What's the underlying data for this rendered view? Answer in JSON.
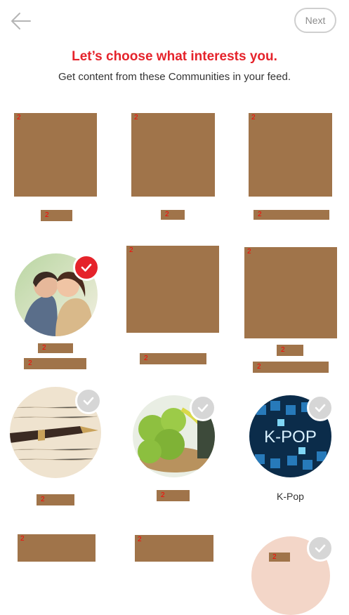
{
  "header": {
    "next_label": "Next",
    "title": "Let’s choose what interests you.",
    "subtitle": "Get content from these Communities in your feed."
  },
  "grid": {
    "placeholder_mark": "2",
    "kpop_label": "K-Pop",
    "kpop_logo_text": "K-POP"
  },
  "colors": {
    "accent": "#e5232b",
    "placeholder": "#a0744a",
    "check_off": "#d6d6d6"
  }
}
